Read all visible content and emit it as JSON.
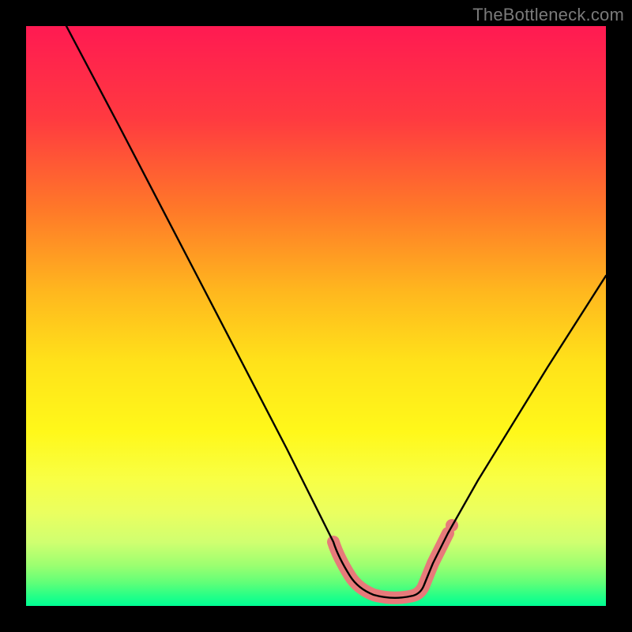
{
  "watermark": {
    "text": "TheBottleneck.com"
  },
  "chart_data": {
    "type": "line",
    "title": "",
    "xlabel": "",
    "ylabel": "",
    "xlim": [
      0,
      100
    ],
    "ylim": [
      0,
      100
    ],
    "series": [
      {
        "name": "bottleneck-curve",
        "x": [
          7,
          16,
          30,
          45,
          53,
          56,
          60,
          65,
          68,
          70,
          73,
          78,
          90,
          100
        ],
        "values": [
          100,
          83,
          56,
          27,
          11,
          5,
          2,
          1,
          2,
          5,
          8,
          17,
          38,
          57
        ]
      }
    ],
    "annotations": [
      {
        "name": "low-band-highlight",
        "x_start": 53,
        "x_end": 73,
        "threshold_y": 8
      }
    ],
    "colors": {
      "curve": "#000000",
      "highlight": "#e77a7a",
      "background_top": "#ff1a52",
      "background_mid": "#ffe21a",
      "background_bottom": "#00ff94"
    }
  }
}
